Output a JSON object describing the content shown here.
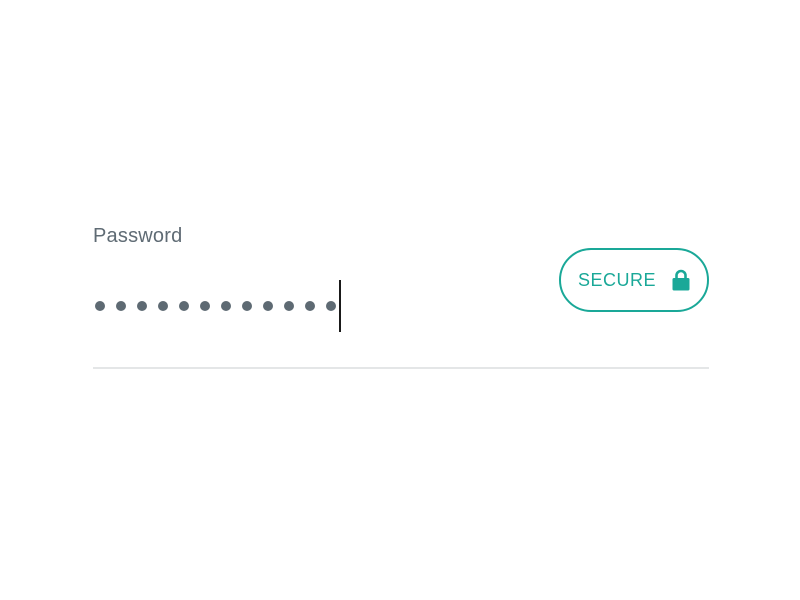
{
  "password_field": {
    "label": "Password",
    "masked_length": 12,
    "mask_char": "•"
  },
  "secure_badge": {
    "label": "SECURE",
    "icon": "lock-icon"
  },
  "colors": {
    "accent": "#1aa898",
    "label_text": "#5f6b74",
    "dot": "#5e6a73",
    "underline": "#e4e6e7",
    "background": "#ffffff"
  }
}
